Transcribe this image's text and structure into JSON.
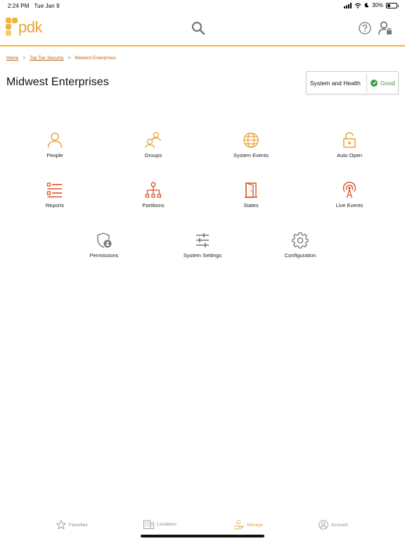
{
  "status_bar": {
    "time": "2:24 PM",
    "date": "Tue Jan 9",
    "battery_text": "30%",
    "battery_level": 0.3
  },
  "header": {
    "logo_text": "pdk",
    "search_icon": "search-icon",
    "help_icon": "question-circle-icon",
    "user_icon": "user-lock-icon"
  },
  "breadcrumb": {
    "items": [
      "Home",
      "Top Tier Security",
      "Midwest Enterprises"
    ],
    "separator": ">"
  },
  "page": {
    "title": "Midwest Enterprises"
  },
  "health": {
    "label": "System and Health",
    "status": "Good",
    "status_color": "#3a9a3a"
  },
  "colors": {
    "accent_orange": "#e8a33a",
    "accent_red": "#d9532b",
    "gray_icon": "#777777"
  },
  "tiles": [
    {
      "label": "People",
      "icon": "person-icon",
      "color": "#e8a33a"
    },
    {
      "label": "Groups",
      "icon": "group-icon",
      "color": "#e8a33a"
    },
    {
      "label": "System Events",
      "icon": "globe-icon",
      "color": "#e8a33a"
    },
    {
      "label": "Auto Open",
      "icon": "unlock-icon",
      "color": "#e8a33a"
    },
    {
      "label": "Reports",
      "icon": "list-icon",
      "color": "#d9532b"
    },
    {
      "label": "Partitions",
      "icon": "hierarchy-icon",
      "color": "#d9532b"
    },
    {
      "label": "States",
      "icon": "door-icon",
      "color": "#d9532b"
    },
    {
      "label": "Live Events",
      "icon": "antenna-icon",
      "color": "#d9532b"
    },
    {
      "label": "Permissions",
      "icon": "shield-user-icon",
      "color": "#777777"
    },
    {
      "label": "System Settings",
      "icon": "sliders-icon",
      "color": "#777777"
    },
    {
      "label": "Configuration",
      "icon": "gear-icon",
      "color": "#777777"
    }
  ],
  "tab_bar": {
    "items": [
      {
        "label": "Favorites",
        "icon": "star-icon",
        "active": false
      },
      {
        "label": "Locations",
        "icon": "building-icon",
        "active": false
      },
      {
        "label": "Manage",
        "icon": "hand-icon",
        "active": true
      },
      {
        "label": "Account",
        "icon": "account-icon",
        "active": false
      }
    ]
  }
}
